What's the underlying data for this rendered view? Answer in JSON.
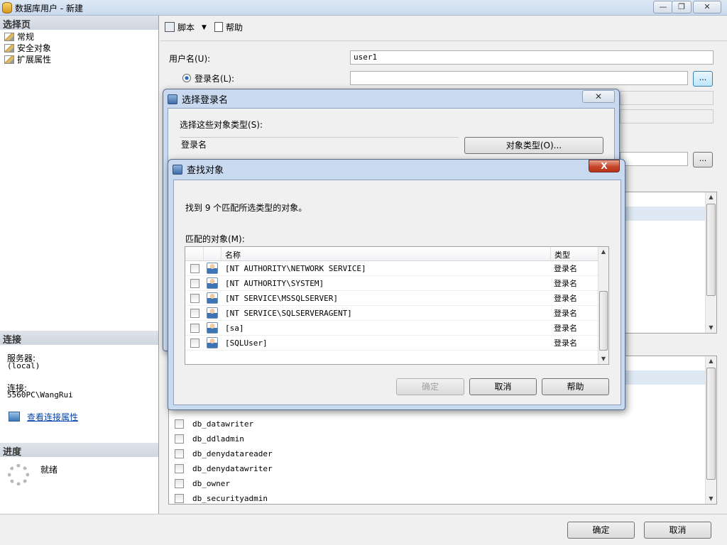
{
  "window": {
    "title": "数据库用户 - 新建",
    "min": "—",
    "max": "❐",
    "close": "✕"
  },
  "left": {
    "select_page_header": "选择页",
    "pages": [
      "常规",
      "安全对象",
      "扩展属性"
    ],
    "connection_header": "连接",
    "server_label": "服务器:",
    "server_value": "(local)",
    "connection_label": "连接:",
    "connection_value": "5560PC\\WangRui",
    "view_conn_link": "查看连接属性",
    "progress_header": "进度",
    "progress_status": "就绪"
  },
  "toolbar": {
    "script_label": "脚本",
    "help_label": "帮助"
  },
  "form": {
    "username_label": "用户名(U):",
    "username_value": "user1",
    "login_radio_label": "登录名(L):",
    "login_value": "",
    "browse_label": "...",
    "browse2_label": "..."
  },
  "roles": [
    "db_datawriter",
    "db_ddladmin",
    "db_denydatareader",
    "db_denydatawriter",
    "db_owner",
    "db_securityadmin"
  ],
  "footer": {
    "ok": "确定",
    "cancel": "取消"
  },
  "select_login_dialog": {
    "title": "选择登录名",
    "object_types_label": "选择这些对象类型(S):",
    "object_types_value": "登录名",
    "object_types_button": "对象类型(O)..."
  },
  "find_objects_dialog": {
    "title": "查找对象",
    "found_text": "找到 9 个匹配所选类型的对象。",
    "matched_label": "匹配的对象(M):",
    "col_name": "名称",
    "col_type": "类型",
    "rows": [
      {
        "name": "[NT AUTHORITY\\NETWORK SERVICE]",
        "type": "登录名"
      },
      {
        "name": "[NT AUTHORITY\\SYSTEM]",
        "type": "登录名"
      },
      {
        "name": "[NT SERVICE\\MSSQLSERVER]",
        "type": "登录名"
      },
      {
        "name": "[NT SERVICE\\SQLSERVERAGENT]",
        "type": "登录名"
      },
      {
        "name": "[sa]",
        "type": "登录名"
      },
      {
        "name": "[SQLUser]",
        "type": "登录名"
      }
    ],
    "ok": "确定",
    "cancel": "取消",
    "help": "帮助",
    "close": "X"
  }
}
